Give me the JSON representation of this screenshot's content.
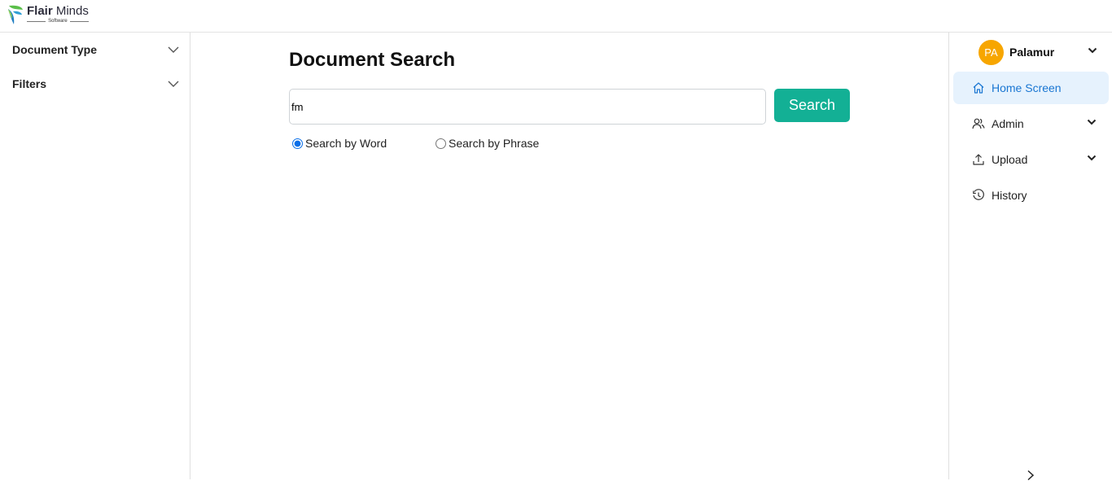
{
  "brand": {
    "name_bold": "Flair",
    "name_rest": " Minds",
    "subtitle": "Software"
  },
  "left_panel": {
    "sections": [
      {
        "label": "Document Type",
        "icon": "chevron-down-icon"
      },
      {
        "label": "Filters",
        "icon": "chevron-down-icon"
      }
    ]
  },
  "main": {
    "title": "Document Search",
    "search": {
      "value": "fm",
      "placeholder": "",
      "button_label": "Search",
      "button_color": "#13b095"
    },
    "search_modes": [
      {
        "label": "Search by Word",
        "selected": true
      },
      {
        "label": "Search by Phrase",
        "selected": false
      }
    ]
  },
  "right_panel": {
    "user": {
      "initials": "PA",
      "name": "Palamur",
      "avatar_color": "#f7a600"
    },
    "nav": [
      {
        "label": "Home Screen",
        "icon": "home-icon",
        "active": true
      },
      {
        "label": "Admin",
        "icon": "admin-users-icon",
        "expandable": true
      },
      {
        "label": "Upload",
        "icon": "upload-icon",
        "expandable": true
      },
      {
        "label": "History",
        "icon": "history-icon"
      }
    ],
    "collapse_icon": "chevron-right-icon",
    "accent_color": "#1976d2"
  }
}
